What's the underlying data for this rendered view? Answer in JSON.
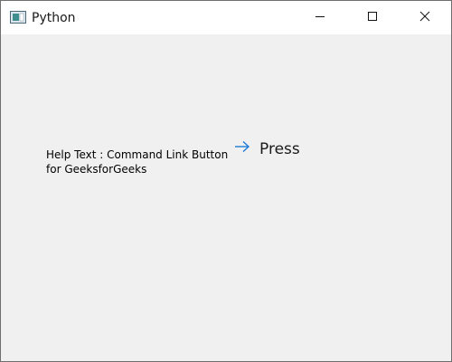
{
  "window": {
    "title": "Python"
  },
  "titlebar": {
    "icons": {
      "app": "app-window-icon",
      "minimize": "minimize-icon",
      "maximize": "maximize-icon",
      "close": "close-icon"
    }
  },
  "content": {
    "help_text": "Help Text : Command Link Button for GeeksforGeeks",
    "command_link": {
      "label": "Press",
      "icon": "arrow-right-icon"
    }
  },
  "colors": {
    "background": "#f0f0f0",
    "titlebar": "#ffffff",
    "accent_arrow": "#1f7ad6",
    "text": "#000000"
  }
}
